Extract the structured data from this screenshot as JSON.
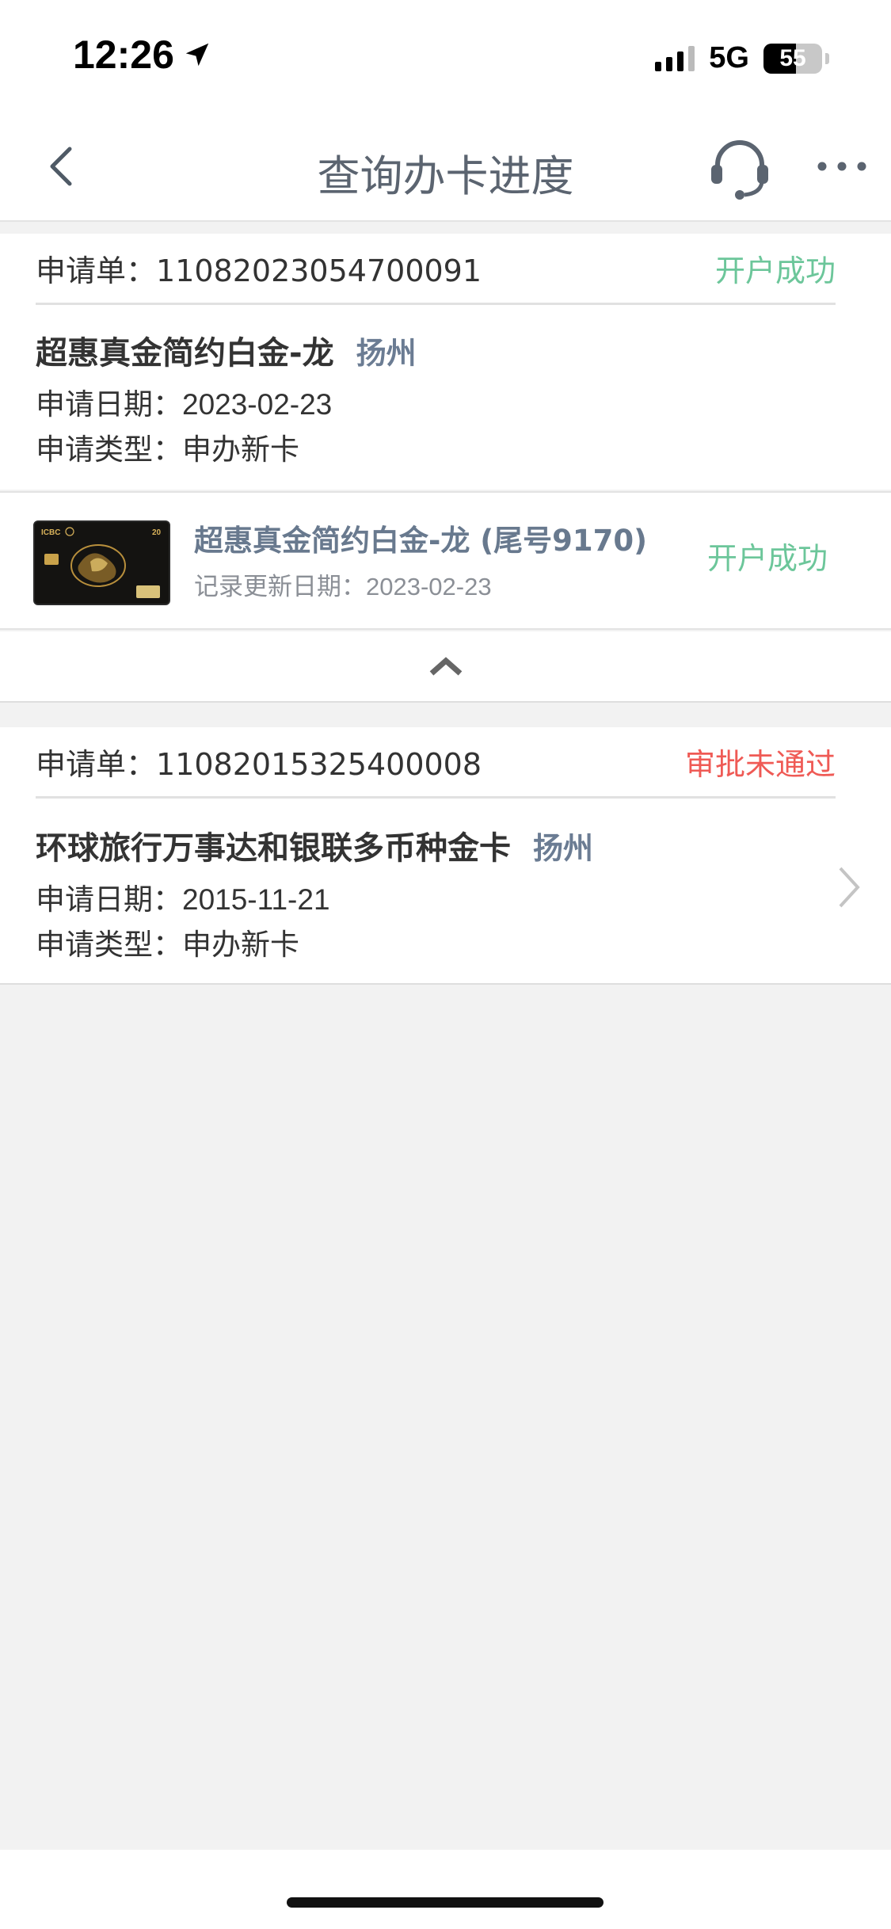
{
  "status_bar": {
    "time": "12:26",
    "network": "5G",
    "battery": "55",
    "battery_fraction": 0.55
  },
  "nav": {
    "title": "查询办卡进度"
  },
  "applications": [
    {
      "number_label": "申请单：",
      "number": "11082023054700091",
      "status": "开户成功",
      "card_name": "超惠真金简约白金-龙",
      "city": "扬州",
      "date_label": "申请日期：",
      "date": "2023-02-23",
      "type_label": "申请类型：",
      "type": "申办新卡",
      "sub_item": {
        "name": "超惠真金简约白金-龙 (尾号9170)",
        "update_label": "记录更新日期：",
        "update_date": "2023-02-23",
        "status": "开户成功",
        "thumb_brand": "ICBC",
        "thumb_badge": "20"
      }
    },
    {
      "number_label": "申请单：",
      "number": "11082015325400008",
      "status": "审批未通过",
      "card_name": "环球旅行万事达和银联多币种金卡",
      "city": "扬州",
      "date_label": "申请日期：",
      "date": "2015-11-21",
      "type_label": "申请类型：",
      "type": "申办新卡"
    }
  ],
  "colors": {
    "success": "#6cc69a",
    "fail": "#ef5a55",
    "accent": "#68798e"
  }
}
